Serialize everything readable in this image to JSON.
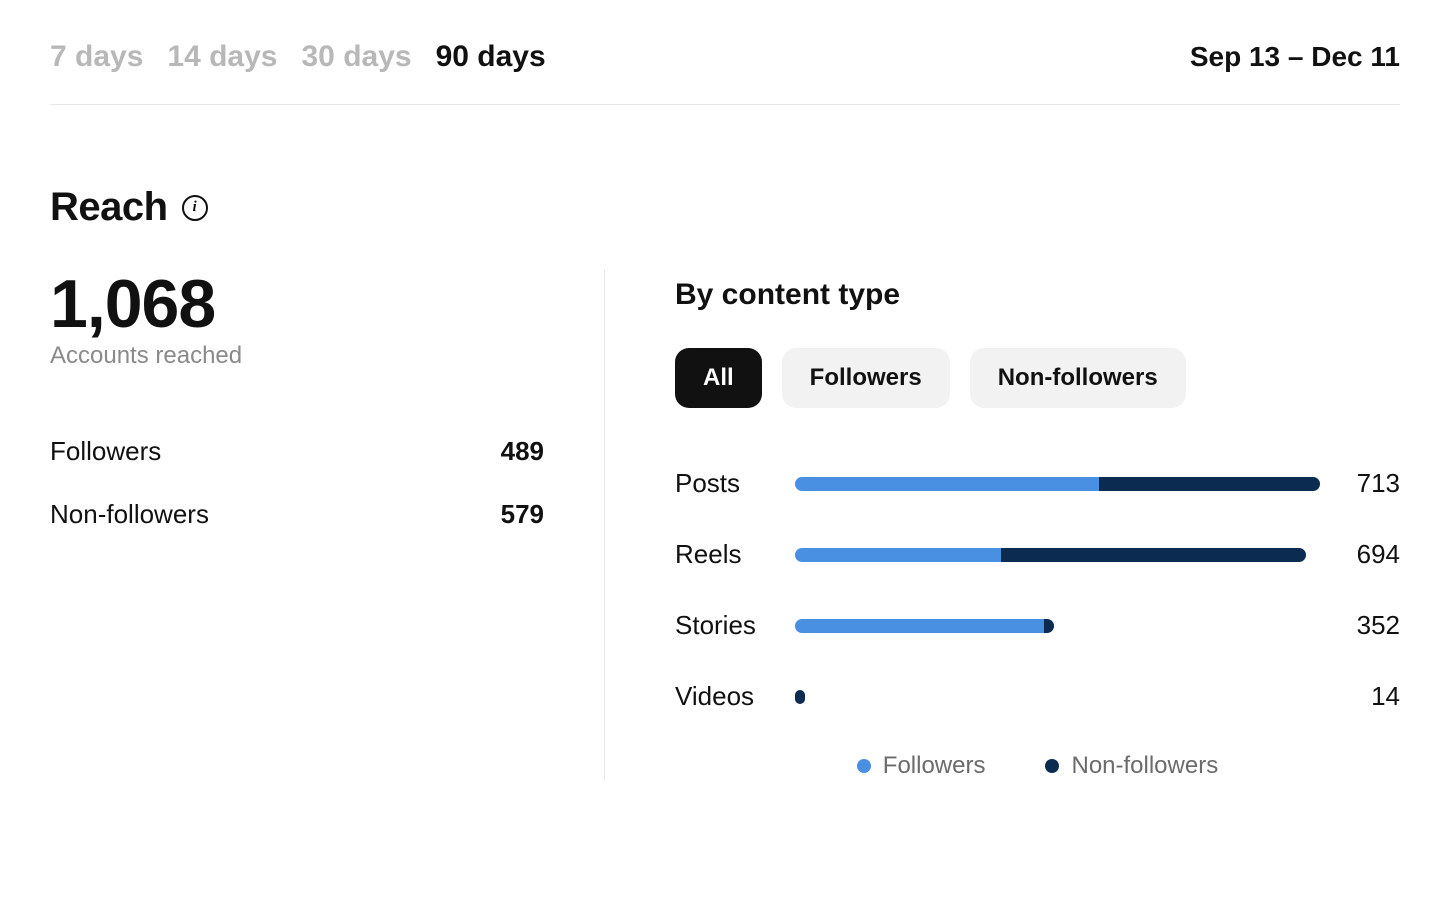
{
  "date_range": "Sep 13 – Dec 11",
  "time_tabs": [
    "7 days",
    "14 days",
    "30 days",
    "90 days"
  ],
  "active_time_tab": 3,
  "section_title": "Reach",
  "total": "1,068",
  "total_label": "Accounts reached",
  "breakdown": [
    {
      "label": "Followers",
      "value": "489"
    },
    {
      "label": "Non-followers",
      "value": "579"
    }
  ],
  "right_title": "By content type",
  "segment_tabs": [
    "All",
    "Followers",
    "Non-followers"
  ],
  "active_segment_tab": 0,
  "legend": [
    {
      "label": "Followers",
      "color": "#4a90e2"
    },
    {
      "label": "Non-followers",
      "color": "#0b2b50"
    }
  ],
  "colors": {
    "followers": "#4a90e2",
    "nonfollowers": "#0b2b50"
  },
  "chart_data": {
    "type": "bar",
    "title": "By content type",
    "categories": [
      "Posts",
      "Reels",
      "Stories",
      "Videos"
    ],
    "series": [
      {
        "name": "Followers",
        "values": [
          413,
          280,
          338,
          0
        ]
      },
      {
        "name": "Non-followers",
        "values": [
          300,
          414,
          14,
          14
        ]
      }
    ],
    "totals": [
      713,
      694,
      352,
      14
    ],
    "xlim": [
      0,
      713
    ]
  }
}
